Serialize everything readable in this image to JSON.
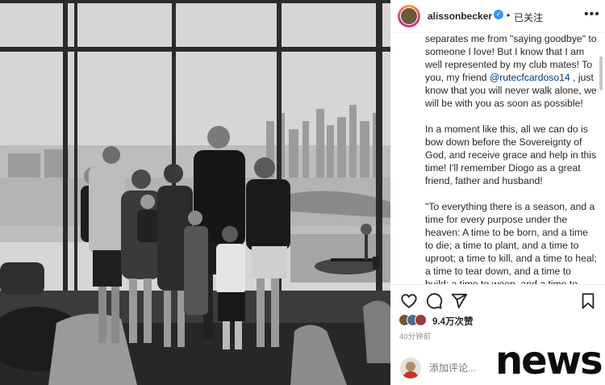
{
  "header": {
    "username": "alissonbecker",
    "separator": "•",
    "follow_status": "已关注",
    "more_label": "•••"
  },
  "caption": {
    "paragraphs": [
      {
        "before": "separates me from \"saying goodbye\" to someone I love! But I know that I am well represented by my club mates! To you, my friend ",
        "mention": "@rutecfcardoso14",
        "after": " , just know that you will never walk alone, we will be with you as soon as possible!"
      },
      {
        "text": "In a moment like this, all we can do is bow down before the Sovereignty of God, and receive grace and help in this time! I'll remember Diogo as a great friend, father and husband!"
      },
      {
        "text": "\"To everything there is a season, and a time for every purpose under the heaven: A time to be born, and a time to die; a time to plant, and a time to uproot; a time to kill, and a time to heal; a time to tear down, and a time to build; a time to weep, and a time to laugh; a time to mourn, and a"
      }
    ]
  },
  "actions": {
    "like_icon": "heart-icon",
    "comment_icon": "comment-icon",
    "share_icon": "share-icon",
    "save_icon": "bookmark-icon"
  },
  "likes": {
    "count_text": "9.4万次赞"
  },
  "timestamp": "40分钟前",
  "comment": {
    "placeholder": "添加评论..."
  },
  "watermark": "news",
  "colors": {
    "verified": "#3897f0",
    "mention": "#00376b",
    "text": "#262626",
    "muted": "#8e8e8e"
  }
}
